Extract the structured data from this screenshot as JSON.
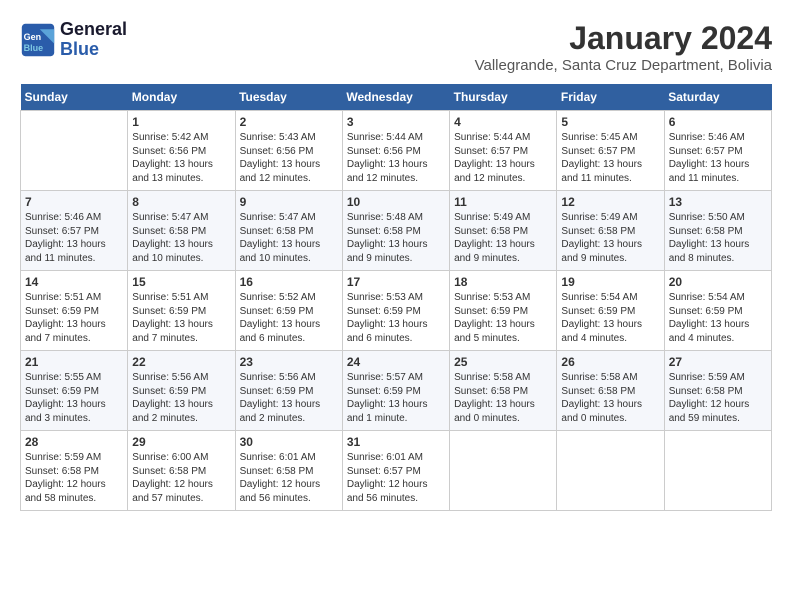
{
  "header": {
    "logo_line1": "General",
    "logo_line2": "Blue",
    "month": "January 2024",
    "location": "Vallegrande, Santa Cruz Department, Bolivia"
  },
  "weekdays": [
    "Sunday",
    "Monday",
    "Tuesday",
    "Wednesday",
    "Thursday",
    "Friday",
    "Saturday"
  ],
  "weeks": [
    [
      {
        "day": "",
        "info": ""
      },
      {
        "day": "1",
        "info": "Sunrise: 5:42 AM\nSunset: 6:56 PM\nDaylight: 13 hours\nand 13 minutes."
      },
      {
        "day": "2",
        "info": "Sunrise: 5:43 AM\nSunset: 6:56 PM\nDaylight: 13 hours\nand 12 minutes."
      },
      {
        "day": "3",
        "info": "Sunrise: 5:44 AM\nSunset: 6:56 PM\nDaylight: 13 hours\nand 12 minutes."
      },
      {
        "day": "4",
        "info": "Sunrise: 5:44 AM\nSunset: 6:57 PM\nDaylight: 13 hours\nand 12 minutes."
      },
      {
        "day": "5",
        "info": "Sunrise: 5:45 AM\nSunset: 6:57 PM\nDaylight: 13 hours\nand 11 minutes."
      },
      {
        "day": "6",
        "info": "Sunrise: 5:46 AM\nSunset: 6:57 PM\nDaylight: 13 hours\nand 11 minutes."
      }
    ],
    [
      {
        "day": "7",
        "info": "Sunrise: 5:46 AM\nSunset: 6:57 PM\nDaylight: 13 hours\nand 11 minutes."
      },
      {
        "day": "8",
        "info": "Sunrise: 5:47 AM\nSunset: 6:58 PM\nDaylight: 13 hours\nand 10 minutes."
      },
      {
        "day": "9",
        "info": "Sunrise: 5:47 AM\nSunset: 6:58 PM\nDaylight: 13 hours\nand 10 minutes."
      },
      {
        "day": "10",
        "info": "Sunrise: 5:48 AM\nSunset: 6:58 PM\nDaylight: 13 hours\nand 9 minutes."
      },
      {
        "day": "11",
        "info": "Sunrise: 5:49 AM\nSunset: 6:58 PM\nDaylight: 13 hours\nand 9 minutes."
      },
      {
        "day": "12",
        "info": "Sunrise: 5:49 AM\nSunset: 6:58 PM\nDaylight: 13 hours\nand 9 minutes."
      },
      {
        "day": "13",
        "info": "Sunrise: 5:50 AM\nSunset: 6:58 PM\nDaylight: 13 hours\nand 8 minutes."
      }
    ],
    [
      {
        "day": "14",
        "info": "Sunrise: 5:51 AM\nSunset: 6:59 PM\nDaylight: 13 hours\nand 7 minutes."
      },
      {
        "day": "15",
        "info": "Sunrise: 5:51 AM\nSunset: 6:59 PM\nDaylight: 13 hours\nand 7 minutes."
      },
      {
        "day": "16",
        "info": "Sunrise: 5:52 AM\nSunset: 6:59 PM\nDaylight: 13 hours\nand 6 minutes."
      },
      {
        "day": "17",
        "info": "Sunrise: 5:53 AM\nSunset: 6:59 PM\nDaylight: 13 hours\nand 6 minutes."
      },
      {
        "day": "18",
        "info": "Sunrise: 5:53 AM\nSunset: 6:59 PM\nDaylight: 13 hours\nand 5 minutes."
      },
      {
        "day": "19",
        "info": "Sunrise: 5:54 AM\nSunset: 6:59 PM\nDaylight: 13 hours\nand 4 minutes."
      },
      {
        "day": "20",
        "info": "Sunrise: 5:54 AM\nSunset: 6:59 PM\nDaylight: 13 hours\nand 4 minutes."
      }
    ],
    [
      {
        "day": "21",
        "info": "Sunrise: 5:55 AM\nSunset: 6:59 PM\nDaylight: 13 hours\nand 3 minutes."
      },
      {
        "day": "22",
        "info": "Sunrise: 5:56 AM\nSunset: 6:59 PM\nDaylight: 13 hours\nand 2 minutes."
      },
      {
        "day": "23",
        "info": "Sunrise: 5:56 AM\nSunset: 6:59 PM\nDaylight: 13 hours\nand 2 minutes."
      },
      {
        "day": "24",
        "info": "Sunrise: 5:57 AM\nSunset: 6:59 PM\nDaylight: 13 hours\nand 1 minute."
      },
      {
        "day": "25",
        "info": "Sunrise: 5:58 AM\nSunset: 6:58 PM\nDaylight: 13 hours\nand 0 minutes."
      },
      {
        "day": "26",
        "info": "Sunrise: 5:58 AM\nSunset: 6:58 PM\nDaylight: 13 hours\nand 0 minutes."
      },
      {
        "day": "27",
        "info": "Sunrise: 5:59 AM\nSunset: 6:58 PM\nDaylight: 12 hours\nand 59 minutes."
      }
    ],
    [
      {
        "day": "28",
        "info": "Sunrise: 5:59 AM\nSunset: 6:58 PM\nDaylight: 12 hours\nand 58 minutes."
      },
      {
        "day": "29",
        "info": "Sunrise: 6:00 AM\nSunset: 6:58 PM\nDaylight: 12 hours\nand 57 minutes."
      },
      {
        "day": "30",
        "info": "Sunrise: 6:01 AM\nSunset: 6:58 PM\nDaylight: 12 hours\nand 56 minutes."
      },
      {
        "day": "31",
        "info": "Sunrise: 6:01 AM\nSunset: 6:57 PM\nDaylight: 12 hours\nand 56 minutes."
      },
      {
        "day": "",
        "info": ""
      },
      {
        "day": "",
        "info": ""
      },
      {
        "day": "",
        "info": ""
      }
    ]
  ]
}
